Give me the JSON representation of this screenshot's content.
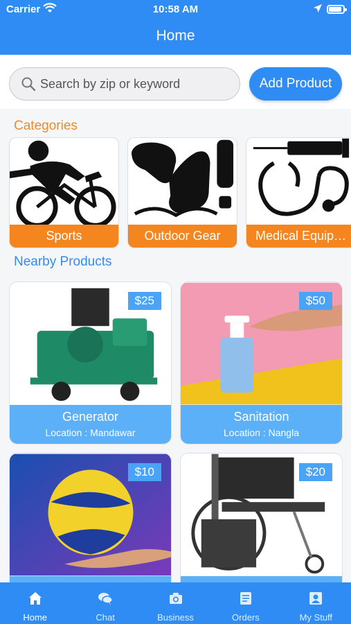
{
  "status_bar": {
    "carrier": "Carrier",
    "time": "10:58 AM"
  },
  "nav": {
    "title": "Home"
  },
  "search": {
    "placeholder": "Search by zip or keyword"
  },
  "add_button": "Add Product",
  "categories": {
    "title": "Categories",
    "items": [
      {
        "label": "Sports",
        "icon": "cyclist-icon"
      },
      {
        "label": "Outdoor Gear",
        "icon": "outdoor-gear-icon"
      },
      {
        "label": "Medical Equip…",
        "icon": "stethoscope-syringe-icon"
      }
    ]
  },
  "nearby": {
    "title": "Nearby Products",
    "items": [
      {
        "price": "$25",
        "name": "Generator",
        "location": "Location : Mandawar",
        "image": "generator-image"
      },
      {
        "price": "$50",
        "name": "Sanitation",
        "location": "Location : Nangla",
        "image": "sanitizer-image"
      },
      {
        "price": "$10",
        "name": "",
        "location": "",
        "image": "volleyball-image"
      },
      {
        "price": "$20",
        "name": "",
        "location": "",
        "image": "wheelchair-image"
      }
    ]
  },
  "tabs": [
    {
      "label": "Home",
      "icon": "home-icon",
      "active": true
    },
    {
      "label": "Chat",
      "icon": "chat-icon",
      "active": false
    },
    {
      "label": "Business",
      "icon": "camera-icon",
      "active": false
    },
    {
      "label": "Orders",
      "icon": "orders-icon",
      "active": false
    },
    {
      "label": "My Stuff",
      "icon": "profile-icon",
      "active": false
    }
  ],
  "colors": {
    "primary": "#2f8cf4",
    "category_accent": "#f5861f",
    "card_info": "#5cb0f7",
    "price_badge": "#4aa3f5"
  }
}
